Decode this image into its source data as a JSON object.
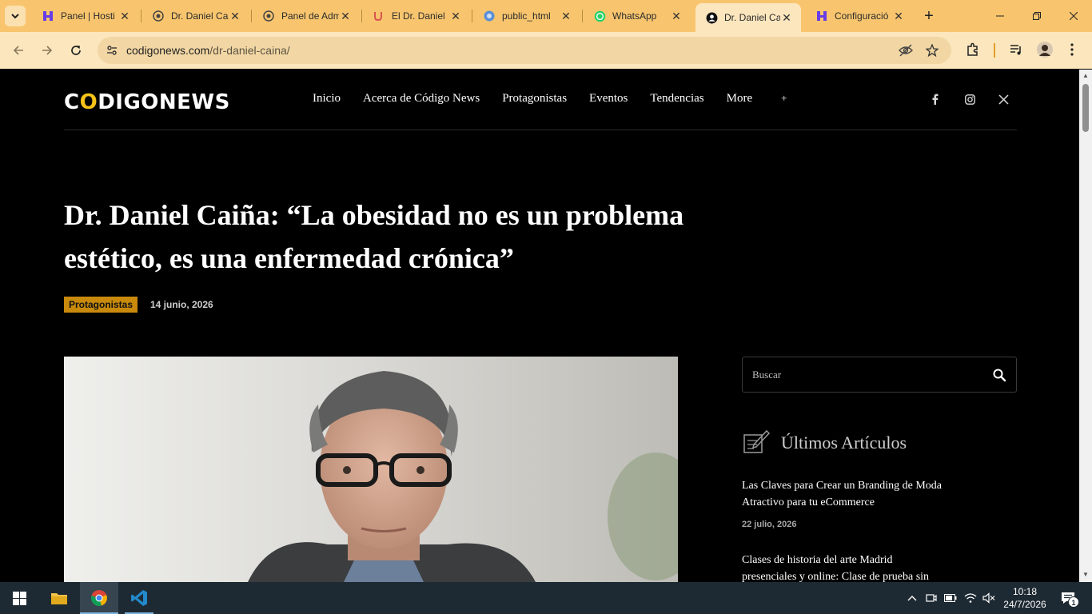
{
  "browser": {
    "tabs": [
      {
        "title": "Panel | Hosti",
        "icon": "hostinger-icon"
      },
      {
        "title": "Dr. Daniel Ca",
        "icon": "wordpress-icon"
      },
      {
        "title": "Panel de Adm",
        "icon": "wordpress-icon"
      },
      {
        "title": "El Dr. Daniel",
        "icon": "u-logo-icon"
      },
      {
        "title": "public_html",
        "icon": "filemanager-icon"
      },
      {
        "title": "WhatsApp",
        "icon": "whatsapp-icon"
      },
      {
        "title": "Dr. Daniel Ca",
        "icon": "site-favicon-icon",
        "active": true
      },
      {
        "title": "Configuració",
        "icon": "hostinger-icon"
      }
    ],
    "url_host": "codigonews.com",
    "url_path": "/dr-daniel-caina/"
  },
  "site": {
    "logo_before": "C",
    "logo_o": "O",
    "logo_after": "DIGONEWS",
    "nav": [
      "Inicio",
      "Acerca de Código News",
      "Protagonistas",
      "Eventos",
      "Tendencias",
      "More"
    ],
    "nav_more_symbol": "+"
  },
  "article": {
    "title": "Dr. Daniel Caiña: “La obesidad no es un problema estético, es una enfermedad crónica”",
    "category": "Protagonistas",
    "date": "14 junio, 2026"
  },
  "sidebar": {
    "search_placeholder": "Buscar",
    "latest_title": "Últimos Artículos",
    "articles": [
      {
        "title": "Las Claves para Crear un Branding de Moda Atractivo para tu eCommerce",
        "date": "22 julio, 2026"
      },
      {
        "title": "Clases de historia del arte Madrid presenciales y online: Clase de prueba sin",
        "date": ""
      }
    ]
  },
  "taskbar": {
    "time": "10:18",
    "date": "24/7/2026",
    "notification_count": "1"
  },
  "colors": {
    "tabbar": "#f8c56e",
    "toolbar": "#fce6bd",
    "accent": "#c98a0c",
    "logo_o": "#f6c21a",
    "taskbar": "#1e2a33"
  }
}
